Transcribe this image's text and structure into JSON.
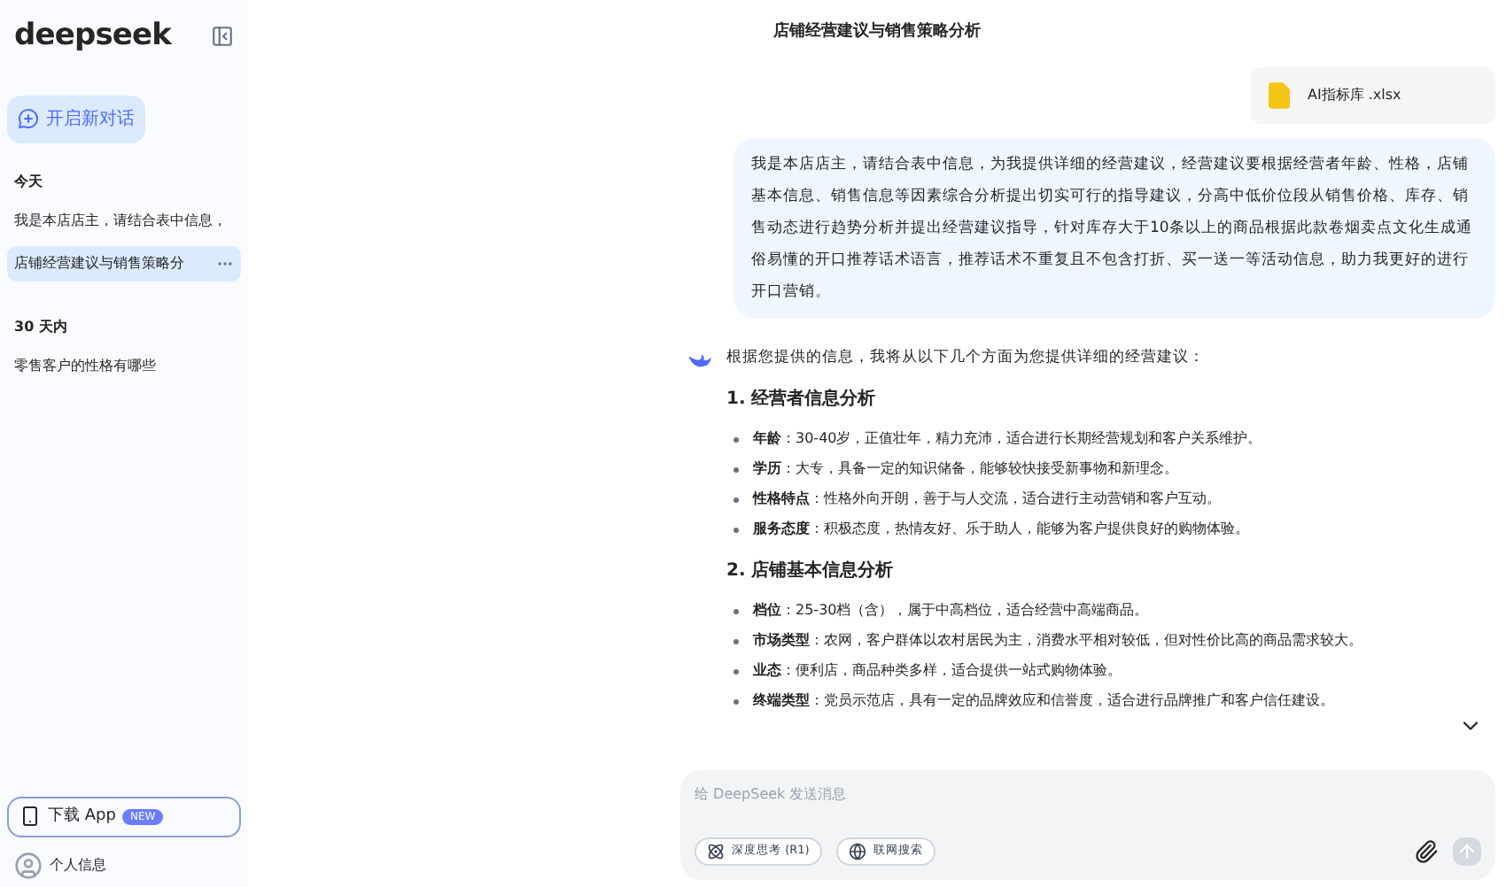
{
  "sidebar": {
    "logo": "deepseek",
    "new_chat": "开启新对话",
    "groups": [
      {
        "title": "今天",
        "items": [
          {
            "label": "我是本店店主，请结合表中信息，",
            "selected": false
          },
          {
            "label": "店铺经营建议与销售策略分",
            "selected": true
          }
        ]
      },
      {
        "title": "30 天内",
        "items": [
          {
            "label": "零售客户的性格有哪些",
            "selected": false
          }
        ]
      }
    ],
    "download": {
      "label": "下载 App",
      "badge": "NEW"
    },
    "profile": "个人信息"
  },
  "chat": {
    "title": "店铺经营建议与销售策略分析",
    "attachment": {
      "name": "AI指标库 .xlsx"
    },
    "user_message": "我是本店店主，请结合表中信息，为我提供详细的经营建议，经营建议要根据经营者年龄、性格，店铺基本信息、销售信息等因素综合分析提出切实可行的指导建议，分高中低价位段从销售价格、库存、销售动态进行趋势分析并提出经营建议指导，针对库存大于10条以上的商品根据此款卷烟卖点文化生成通俗易懂的开口推荐话术语言，推荐话术不重复且不包含打折、买一送一等活动信息，助力我更好的进行开口营销。",
    "reply_intro": "根据您提供的信息，我将从以下几个方面为您提供详细的经营建议：",
    "sections": [
      {
        "heading": "1. 经营者信息分析",
        "bullets": [
          "**年龄**：30-40岁，正值壮年，精力充沛，适合进行长期经营规划和客户关系维护。",
          "**学历**：大专，具备一定的知识储备，能够较快接受新事物和新理念。",
          "**性格特点**：性格外向开朗，善于与人交流，适合进行主动营销和客户互动。",
          "**服务态度**：积极态度，热情友好、乐于助人，能够为客户提供良好的购物体验。"
        ]
      },
      {
        "heading": "2. 店铺基本信息分析",
        "bullets": [
          "**档位**：25-30档（含），属于中高档位，适合经营中高端商品。",
          "**市场类型**：农网，客户群体以农村居民为主，消费水平相对较低，但对性价比高的商品需求较大。",
          "**业态**：便利店，商品种类多样，适合提供一站式购物体验。",
          "**终端类型**：党员示范店，具有一定的品牌效应和信誉度，适合进行品牌推广和客户信任建设。"
        ]
      }
    ],
    "input": {
      "placeholder": "给 DeepSeek 发送消息",
      "toggles": [
        {
          "label": "深度思考 (R1)",
          "on": false
        },
        {
          "label": "联网搜索",
          "on": false
        }
      ]
    }
  }
}
